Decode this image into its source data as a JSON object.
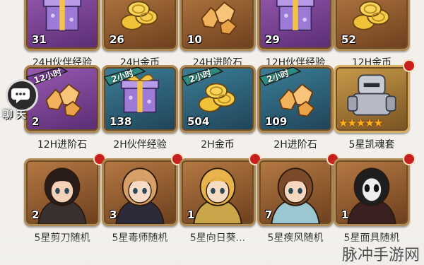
{
  "rows": [
    [
      {
        "label": "24H伙伴经验",
        "qty": "31",
        "style": "purple",
        "art": "gift"
      },
      {
        "label": "24H金币",
        "qty": "26",
        "style": "brown",
        "art": "coins"
      },
      {
        "label": "24H进阶石",
        "qty": "10",
        "style": "brown",
        "art": "stones"
      },
      {
        "label": "12H伙伴经验",
        "qty": "29",
        "style": "purple",
        "art": "gift"
      },
      {
        "label": "12H金币",
        "qty": "52",
        "style": "brown",
        "art": "coins"
      }
    ],
    [
      {
        "label": "12H进阶石",
        "qty": "2",
        "style": "purple",
        "art": "stones",
        "badge": "12小时"
      },
      {
        "label": "2H伙伴经验",
        "qty": "138",
        "style": "blue",
        "art": "gift",
        "badge": "2小时"
      },
      {
        "label": "2H金币",
        "qty": "504",
        "style": "blue",
        "art": "coins",
        "badge": "2小时"
      },
      {
        "label": "2H进阶石",
        "qty": "109",
        "style": "blue",
        "art": "stones",
        "badge": "2小时"
      },
      {
        "label": "5星凯魂套",
        "qty": "",
        "style": "gold",
        "art": "armor",
        "stars": "★★★★★",
        "dot": true
      }
    ],
    [
      {
        "label": "5星剪刀随机",
        "qty": "2",
        "style": "brown",
        "art": "hero1",
        "dot": true
      },
      {
        "label": "5星毒师随机",
        "qty": "3",
        "style": "brown",
        "art": "hero2",
        "dot": true
      },
      {
        "label": "5星向日葵...",
        "qty": "1",
        "style": "brown",
        "art": "hero3",
        "dot": true
      },
      {
        "label": "5星疾风随机",
        "qty": "7",
        "style": "brown",
        "art": "hero4",
        "dot": true
      },
      {
        "label": "5星面具随机",
        "qty": "1",
        "style": "brown",
        "art": "hero5",
        "dot": true
      }
    ]
  ],
  "chat": {
    "label": "聊 天",
    "icon": "chat-bubble-icon"
  },
  "watermark": "脉冲手游网"
}
